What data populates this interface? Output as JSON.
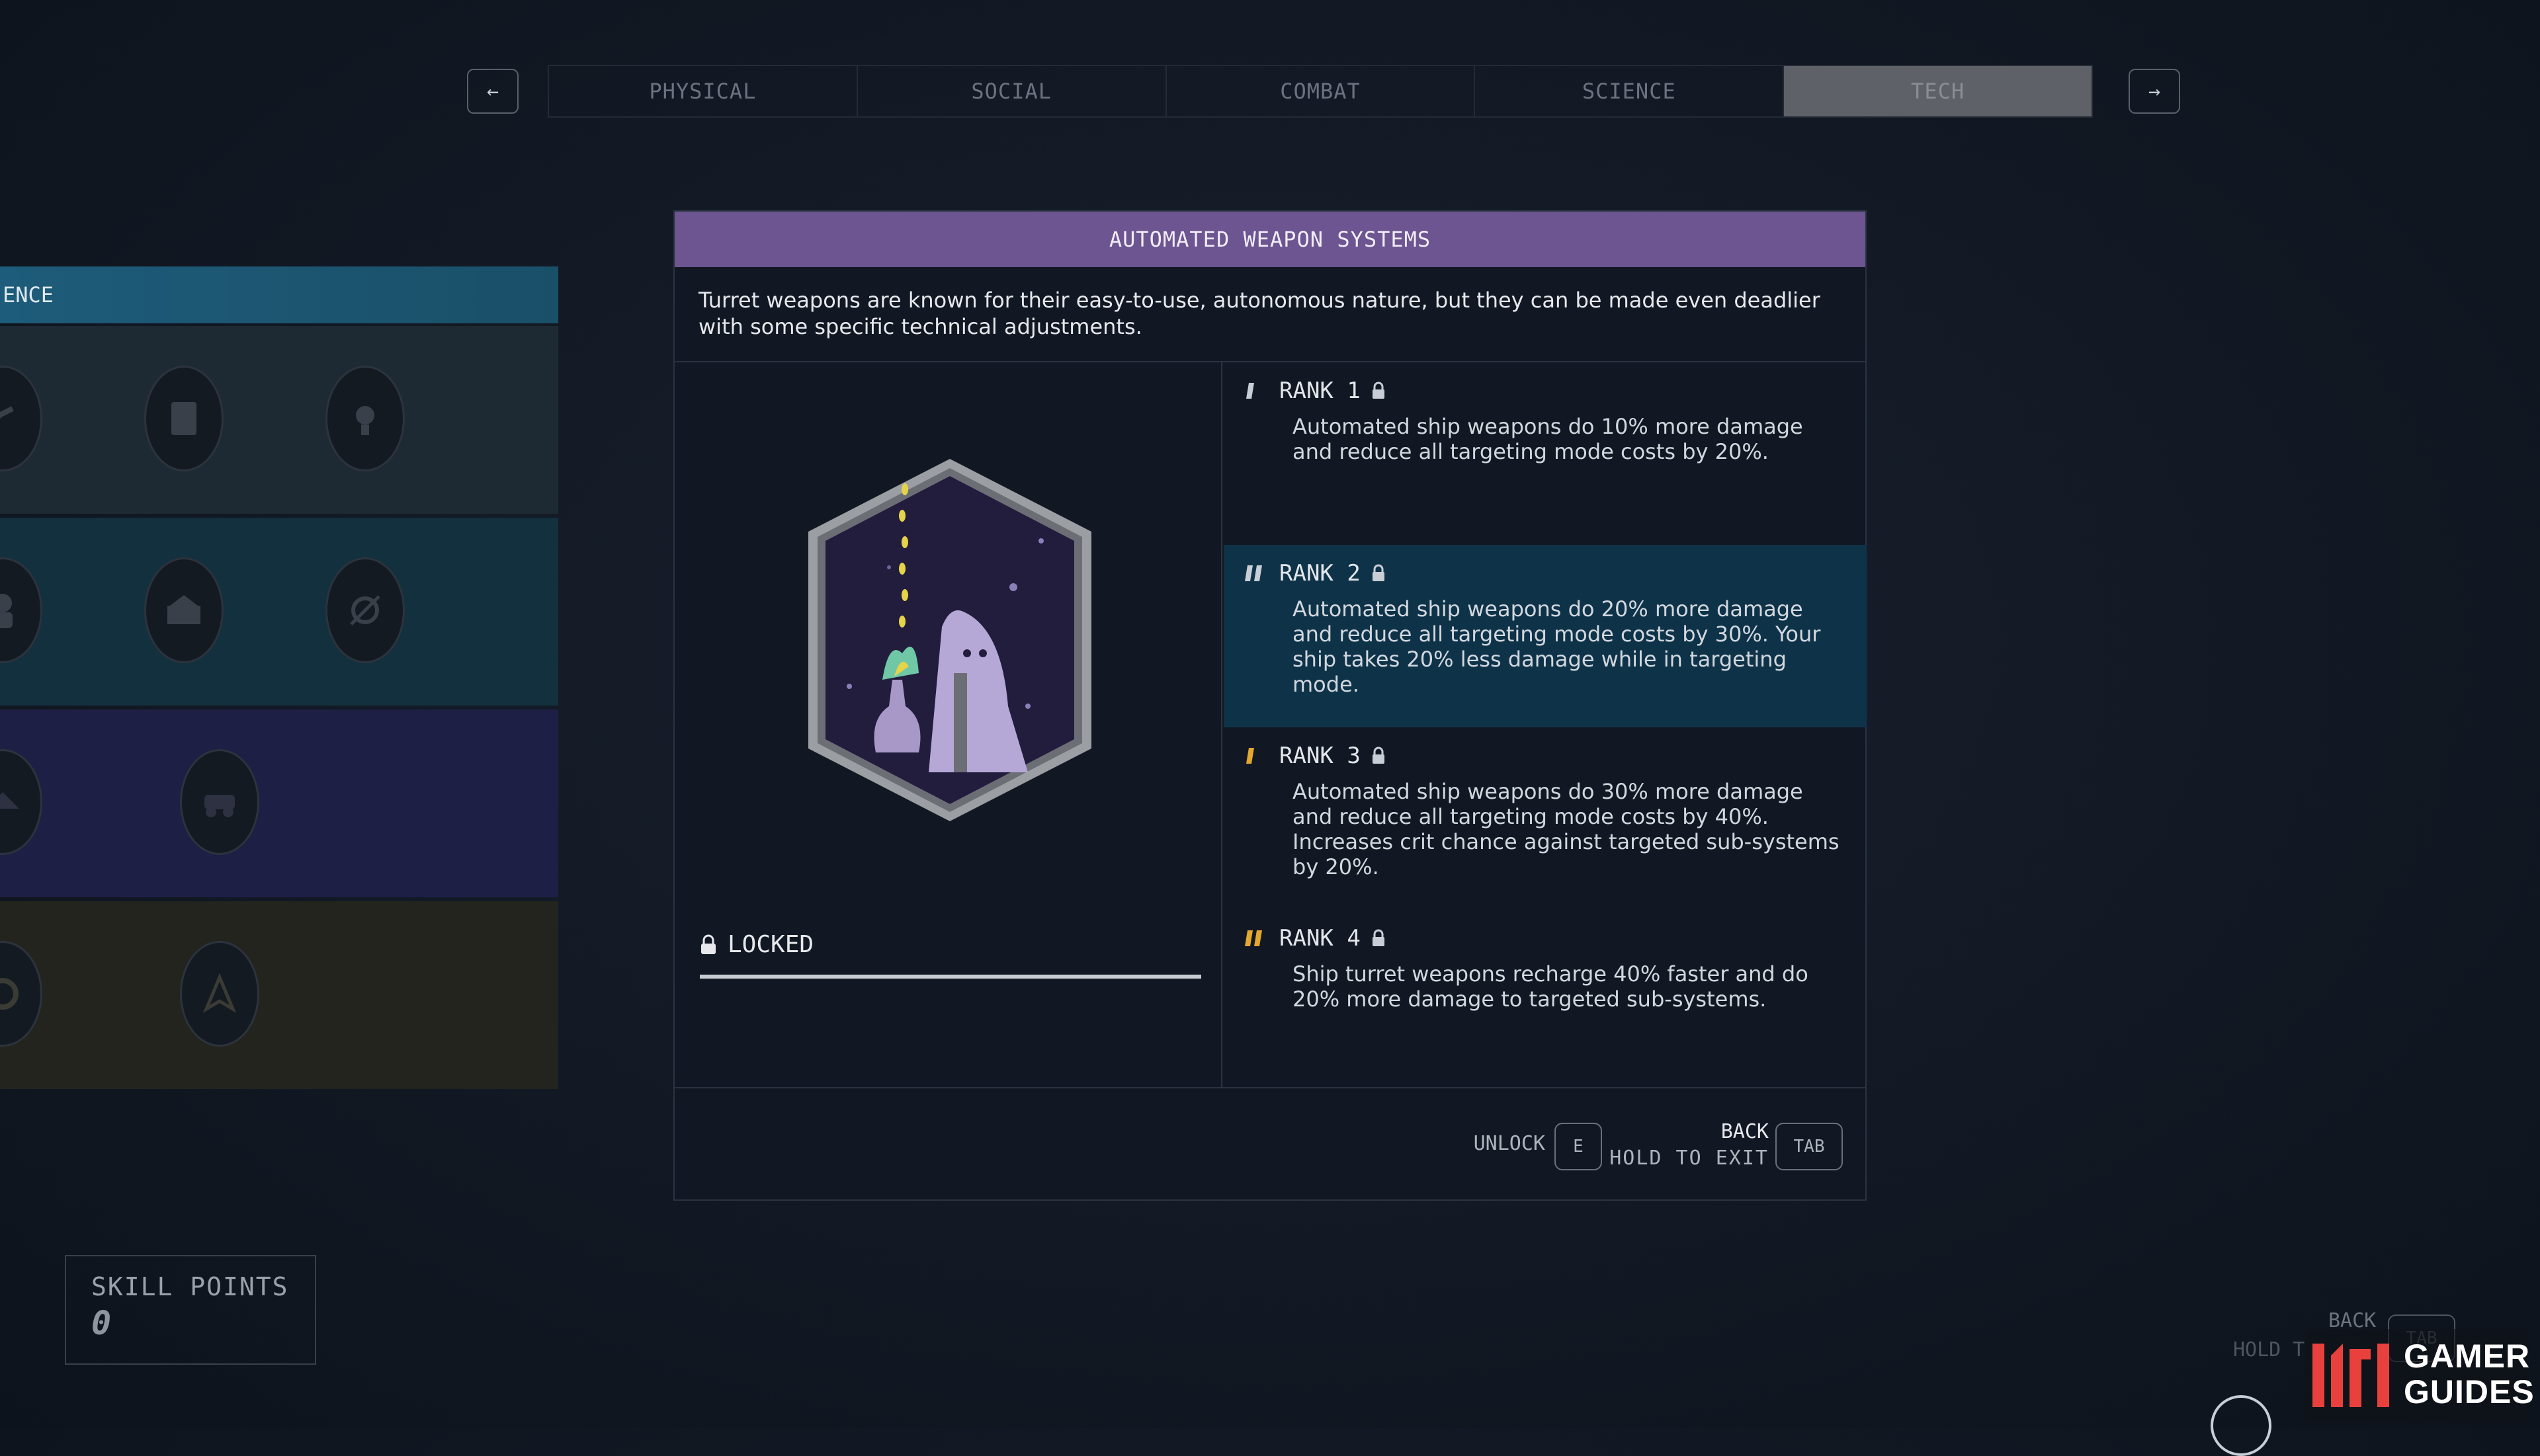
{
  "nav": {
    "prev_arrow": "←",
    "next_arrow": "→",
    "tabs": [
      {
        "label": "PHYSICAL",
        "active": false
      },
      {
        "label": "SOCIAL",
        "active": false
      },
      {
        "label": "COMBAT",
        "active": false
      },
      {
        "label": "SCIENCE",
        "active": false
      },
      {
        "label": "TECH",
        "active": true
      }
    ]
  },
  "left_panel": {
    "header": "ENCE",
    "rows": [
      {
        "icons": [
          "robot-arm-icon",
          "datapad-icon",
          "lightbulb-signal-icon"
        ]
      },
      {
        "icons": [
          "astronaut-icon",
          "weapon-crate-icon",
          "orbit-target-icon"
        ]
      },
      {
        "icons": [
          "ship-icon",
          "rover-icon"
        ]
      },
      {
        "icons": [
          "gear-icon",
          "compass-icon"
        ]
      }
    ]
  },
  "skill_points": {
    "label": "SKILL POINTS",
    "value": "0"
  },
  "card": {
    "title": "AUTOMATED WEAPON SYSTEMS",
    "description": "Turret weapons are known for their easy-to-use, autonomous nature, but they can be made even deadlier with some specific technical adjustments.",
    "status": "LOCKED",
    "ranks": [
      {
        "label": "RANK 1",
        "text": "Automated ship weapons do 10% more damage and reduce all targeting mode costs by 20%."
      },
      {
        "label": "RANK 2",
        "text": "Automated ship weapons do 20% more damage and reduce all targeting mode costs by 30%. Your ship takes 20% less damage while in targeting mode."
      },
      {
        "label": "RANK 3",
        "text": "Automated ship weapons do 30% more damage and reduce all targeting mode costs by 40%. Increases crit chance against targeted sub-systems by 20%."
      },
      {
        "label": "RANK 4",
        "text": "Ship turret weapons recharge 40% faster and do 20% more damage to targeted sub-systems."
      }
    ],
    "footer": {
      "unlock_label": "UNLOCK",
      "unlock_key": "E",
      "back_label": "BACK",
      "hold_label": "HOLD TO EXIT",
      "back_key": "TAB"
    }
  },
  "overlay": {
    "faded_back": "BACK",
    "faded_hold": "HOLD T",
    "faded_key": "TAB",
    "logo_line1": "GAMER",
    "logo_line2": "GUIDES"
  },
  "colors": {
    "title_bar": "#6c5590",
    "highlight_rank": "#0e3349",
    "rank_pip": "#e2a72e",
    "logo_accent": "#e8413d"
  }
}
